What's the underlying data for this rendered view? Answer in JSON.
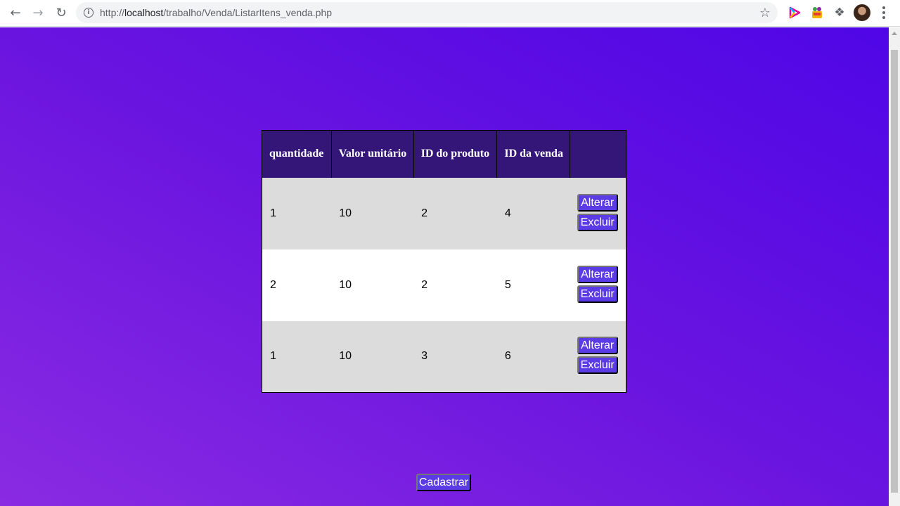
{
  "browser": {
    "url_scheme": "http://",
    "url_host": "localhost",
    "url_path": "/trabalho/Venda/ListarItens_venda.php"
  },
  "icons": {
    "back": "arrow-left",
    "forward": "arrow-right",
    "reload": "reload",
    "info": "info-circle",
    "bookmark": "star",
    "extension1": "play-store",
    "extension2": "colorful-extension",
    "extensions": "puzzle",
    "profile": "avatar",
    "menu": "kebab-menu"
  },
  "colors": {
    "header_bg": "#341678",
    "row_odd": "#dcdcdc",
    "row_even": "#ffffff",
    "button_bg": "#5a3be6",
    "gradient_start": "#8a2be2",
    "gradient_end": "#4f06e6"
  },
  "table": {
    "headers": [
      "quantidade",
      "Valor unitário",
      "ID do produto",
      "ID da venda",
      ""
    ],
    "rows": [
      {
        "quantidade": "1",
        "valor": "10",
        "produto": "2",
        "venda": "4"
      },
      {
        "quantidade": "2",
        "valor": "10",
        "produto": "2",
        "venda": "5"
      },
      {
        "quantidade": "1",
        "valor": "10",
        "produto": "3",
        "venda": "6"
      }
    ],
    "edit_label": "Alterar",
    "delete_label": "Excluir"
  },
  "footer": {
    "cadastrar_label": "Cadastrar"
  }
}
